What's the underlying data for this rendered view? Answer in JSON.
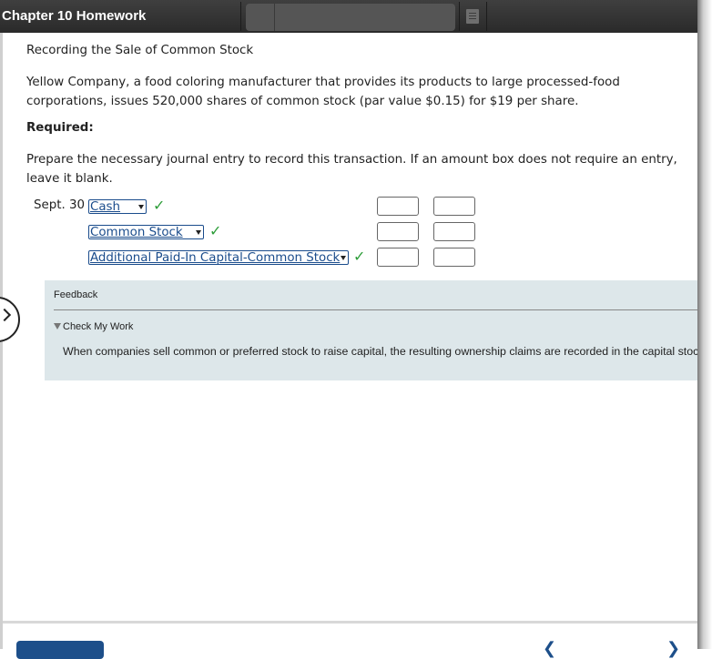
{
  "header": {
    "title": "Chapter 10 Homework",
    "icons": [
      "doc-icon"
    ]
  },
  "problem": {
    "heading": "Recording the Sale of Common Stock",
    "description": "Yellow Company, a food coloring manufacturer that provides its products to large processed-food corporations, issues 520,000 shares of common stock (par value $0.15) for $19 per share.",
    "required_label": "Required:",
    "instruction": "Prepare the necessary journal entry to record this transaction. If an amount box does not require an entry, leave it blank."
  },
  "journal": {
    "date": "Sept. 30",
    "rows": [
      {
        "account": "Cash",
        "status": "correct",
        "debit": "",
        "credit": ""
      },
      {
        "account": "Common Stock",
        "status": "correct",
        "debit": "",
        "credit": ""
      },
      {
        "account": "Additional Paid-In Capital-Common Stock",
        "status": "correct",
        "debit": "",
        "credit": ""
      }
    ],
    "check_glyph": "✓"
  },
  "feedback": {
    "title": "Feedback",
    "section": "Check My Work",
    "text": "When companies sell common or preferred stock to raise capital, the resulting ownership claims are recorded in the capital stock section"
  },
  "colors": {
    "accent": "#1a4c8c",
    "correct": "#2e9e3a",
    "feedback_bg": "#dde7ea"
  }
}
